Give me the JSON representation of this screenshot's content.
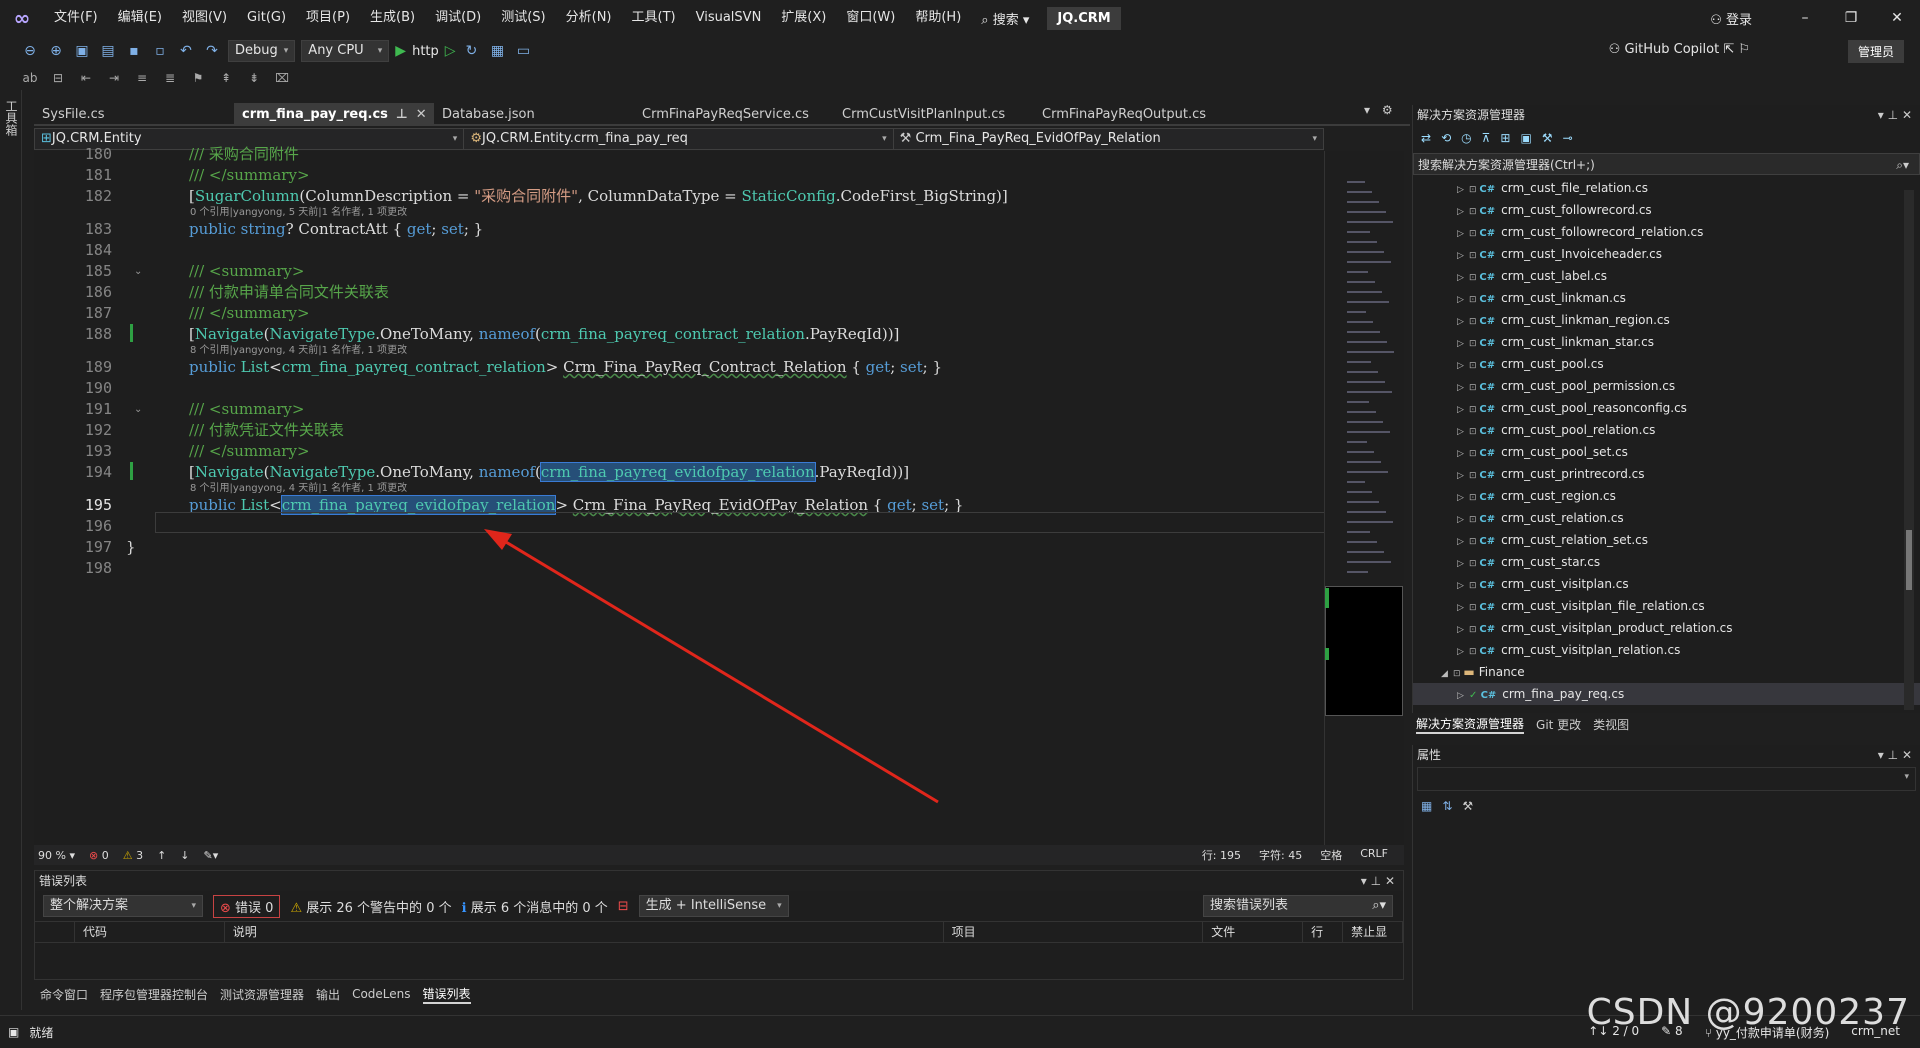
{
  "menu": {
    "items": [
      "文件(F)",
      "编辑(E)",
      "视图(V)",
      "Git(G)",
      "项目(P)",
      "生成(B)",
      "调试(D)",
      "测试(S)",
      "分析(N)",
      "工具(T)",
      "VisualSVN",
      "扩展(X)",
      "窗口(W)",
      "帮助(H)"
    ],
    "search": "搜索",
    "solution_name": "JQ.CRM",
    "login": "登录"
  },
  "toolbar": {
    "config": "Debug",
    "platform": "Any CPU",
    "run_target": "http",
    "copilot": "GitHub Copilot",
    "admin": "管理员"
  },
  "toolbox_label": "工具箱",
  "tabs": [
    {
      "label": "SysFile.cs",
      "active": false
    },
    {
      "label": "crm_fina_pay_req.cs",
      "active": true
    },
    {
      "label": "Database.json",
      "active": false
    },
    {
      "label": "CrmFinaPayReqService.cs",
      "active": false
    },
    {
      "label": "CrmCustVisitPlanInput.cs",
      "active": false
    },
    {
      "label": "CrmFinaPayReqOutput.cs",
      "active": false
    }
  ],
  "navbar": {
    "project": "JQ.CRM.Entity",
    "class": "JQ.CRM.Entity.crm_fina_pay_req",
    "member": "Crm_Fina_PayReq_EvidOfPay_Relation"
  },
  "code": {
    "lines": [
      {
        "n": "180",
        "text": "/// 采购合同附件"
      },
      {
        "n": "181",
        "text": "/// </summary>"
      },
      {
        "n": "182",
        "text": "[SugarColumn(ColumnDescription = \"采购合同附件\", ColumnDataType = StaticConfig.CodeFirst_BigString)]"
      },
      {
        "n": "183",
        "text": "public string? ContractAtt { get; set; }"
      },
      {
        "n": "184",
        "text": ""
      },
      {
        "n": "185",
        "text": "/// <summary>"
      },
      {
        "n": "186",
        "text": "/// 付款申请单合同文件关联表"
      },
      {
        "n": "187",
        "text": "/// </summary>"
      },
      {
        "n": "188",
        "text": "[Navigate(NavigateType.OneToMany, nameof(crm_fina_payreq_contract_relation.PayReqId))]"
      },
      {
        "n": "189",
        "text": "public List<crm_fina_payreq_contract_relation> Crm_Fina_PayReq_Contract_Relation { get; set; }"
      },
      {
        "n": "190",
        "text": ""
      },
      {
        "n": "191",
        "text": "/// <summary>"
      },
      {
        "n": "192",
        "text": "/// 付款凭证文件关联表"
      },
      {
        "n": "193",
        "text": "/// </summary>"
      },
      {
        "n": "194",
        "text": "[Navigate(NavigateType.OneToMany, nameof(crm_fina_payreq_evidofpay_relation.PayReqId))]"
      },
      {
        "n": "195",
        "text": "public List<crm_fina_payreq_evidofpay_relation> Crm_Fina_PayReq_EvidOfPay_Relation { get; set; }"
      },
      {
        "n": "196",
        "text": ""
      },
      {
        "n": "197",
        "text": "}"
      },
      {
        "n": "198",
        "text": ""
      }
    ],
    "lens": {
      "l182": "0 个引用|yangyong, 5 天前|1 名作者, 1 项更改",
      "l188": "8 个引用|yangyong, 4 天前|1 名作者, 1 项更改",
      "l194": "8 个引用|yangyong, 4 天前|1 名作者, 1 项更改"
    }
  },
  "editor_status": {
    "zoom": "90 %",
    "errors": "0",
    "warnings": "3",
    "line": "行: 195",
    "col": "字符: 45",
    "whitespace": "空格",
    "eol": "CRLF"
  },
  "errlist": {
    "title": "错误列表",
    "scope": "整个解决方案",
    "errors_pill": "错误 0",
    "warnings": "展示 26 个警告中的 0 个",
    "messages": "展示 6 个消息中的 0 个",
    "build": "生成 + IntelliSense",
    "search": "搜索错误列表",
    "cols": [
      "代码",
      "说明",
      "项目",
      "文件",
      "行",
      "禁止显"
    ]
  },
  "bottom_tabs": [
    "命令窗口",
    "程序包管理器控制台",
    "测试资源管理器",
    "输出",
    "CodeLens",
    "错误列表"
  ],
  "solexp": {
    "title": "解决方案资源管理器",
    "search": "搜索解决方案资源管理器(Ctrl+;)",
    "items": [
      "crm_cust_file_relation.cs",
      "crm_cust_followrecord.cs",
      "crm_cust_followrecord_relation.cs",
      "crm_cust_Invoiceheader.cs",
      "crm_cust_label.cs",
      "crm_cust_linkman.cs",
      "crm_cust_linkman_region.cs",
      "crm_cust_linkman_star.cs",
      "crm_cust_pool.cs",
      "crm_cust_pool_permission.cs",
      "crm_cust_pool_reasonconfig.cs",
      "crm_cust_pool_relation.cs",
      "crm_cust_pool_set.cs",
      "crm_cust_printrecord.cs",
      "crm_cust_region.cs",
      "crm_cust_relation.cs",
      "crm_cust_relation_set.cs",
      "crm_cust_star.cs",
      "crm_cust_visitplan.cs",
      "crm_cust_visitplan_file_relation.cs",
      "crm_cust_visitplan_product_relation.cs",
      "crm_cust_visitplan_relation.cs"
    ],
    "folder": "Finance",
    "selected": "crm_fina_pay_req.cs",
    "tabs": [
      "解决方案资源管理器",
      "Git 更改",
      "类视图"
    ]
  },
  "props": {
    "title": "属性"
  },
  "statusbar": {
    "ready": "就绪",
    "lines": "↑↓ 2 / 0",
    "edits": "8",
    "branch": "yy_付款申请单(财务)",
    "repo": "crm_net"
  },
  "watermark": "CSDN @9200237",
  "colors": {
    "accent": "#3794ff",
    "highlight": "#264f78",
    "arrow": "#e0261b"
  }
}
